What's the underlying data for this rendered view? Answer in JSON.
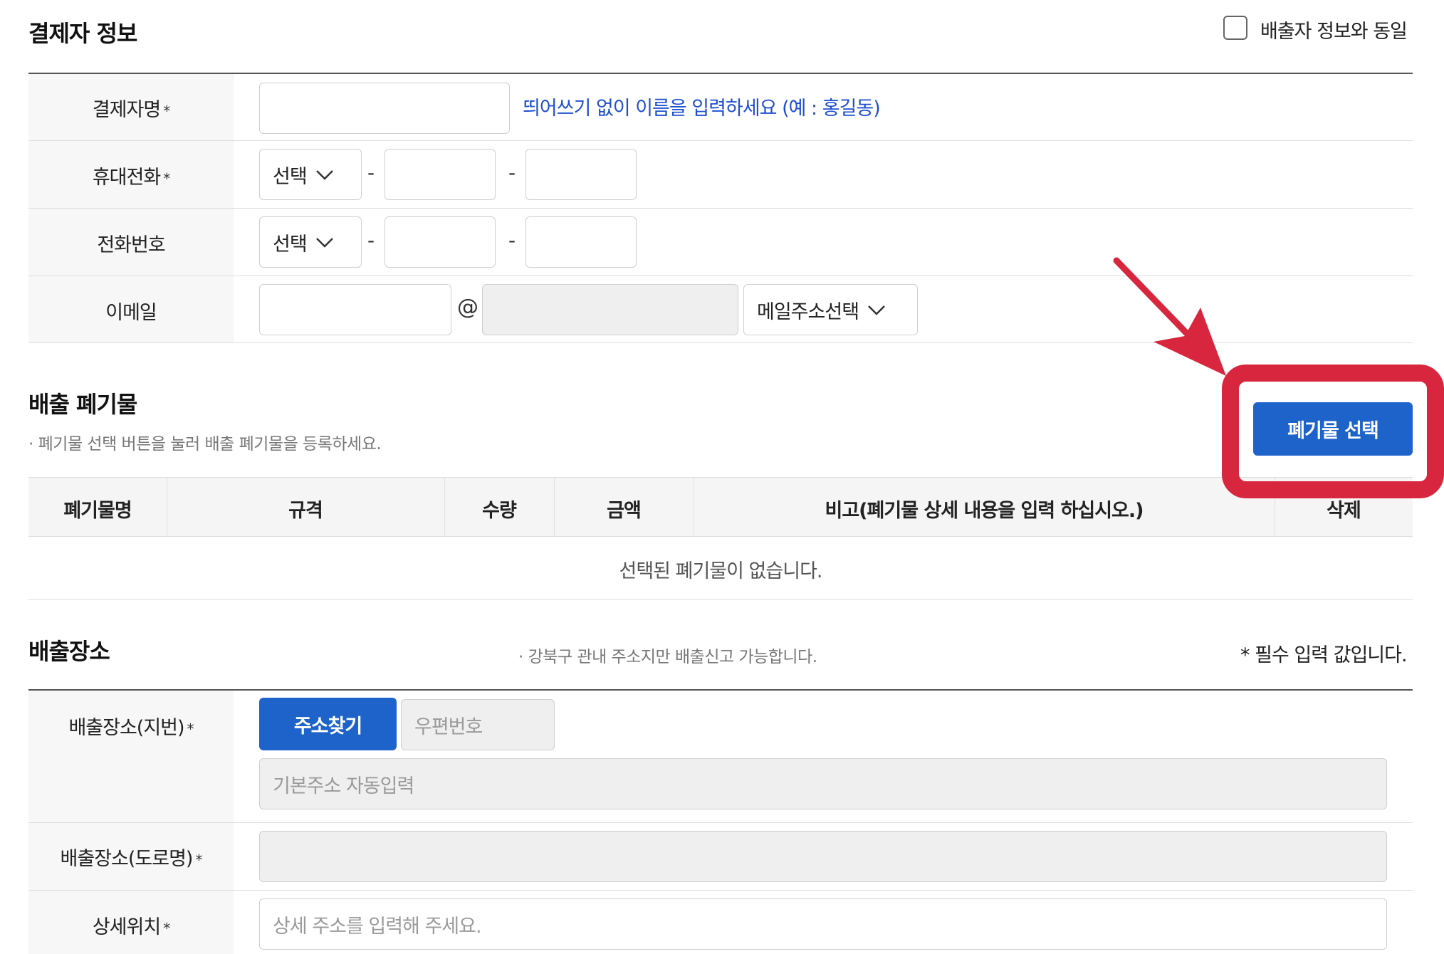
{
  "payer": {
    "title": "결제자 정보",
    "same_as_discharger_label": "배출자 정보와 동일",
    "fields": {
      "name_label": "결제자명",
      "name_hint": "띄어쓰기 없이 이름을 입력하세요 (예 : 홍길동)",
      "mobile_label": "휴대전화",
      "mobile_select": "선택",
      "phone_label": "전화번호",
      "phone_select": "선택",
      "email_label": "이메일",
      "email_at": "@",
      "email_domain_select": "메일주소선택",
      "dash": "-",
      "required_mark": "*"
    }
  },
  "waste": {
    "title": "배출 폐기물",
    "subtitle": "· 폐기물 선택 버튼을 눌러 배출 폐기물을 등록하세요.",
    "select_button": "폐기물 선택",
    "columns": [
      "폐기물명",
      "규격",
      "수량",
      "금액",
      "비고(폐기물 상세 내용을 입력 하십시오.)",
      "삭제"
    ],
    "empty_message": "선택된 폐기물이 없습니다."
  },
  "location": {
    "title": "배출장소",
    "notice": "· 강북구 관내 주소지만 배출신고 가능합니다.",
    "required_notice": "* 필수 입력 값입니다.",
    "lot_label": "배출장소(지번)",
    "find_address_button": "주소찾기",
    "postal_placeholder": "우편번호",
    "base_address_placeholder": "기본주소 자동입력",
    "road_label": "배출장소(도로명)",
    "detail_label": "상세위치",
    "detail_placeholder": "상세 주소를 입력해 주세요."
  },
  "colors": {
    "accent_blue": "#1e63c9",
    "hint_blue": "#1f4fd0",
    "annotation_red": "#d7263d"
  }
}
